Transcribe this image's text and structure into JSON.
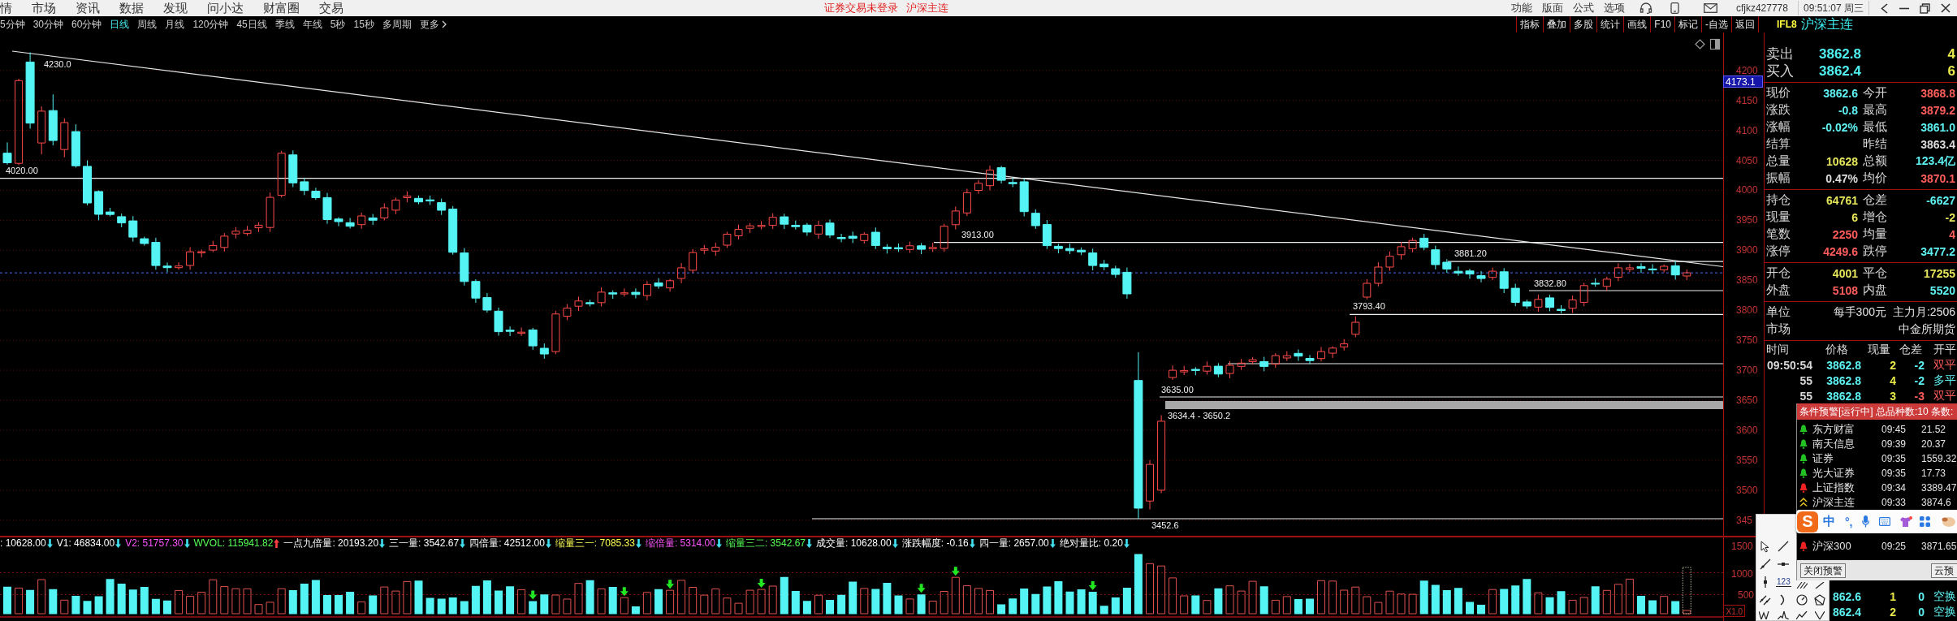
{
  "menu": {
    "items": [
      "情",
      "市场",
      "资讯",
      "数据",
      "发现",
      "问小达",
      "财富圈",
      "交易"
    ],
    "notices": [
      "证券交易未登录",
      "沪深主连"
    ],
    "links": [
      "功能",
      "版面",
      "公式",
      "选项"
    ],
    "account": "cfjkz427778",
    "clock": "09:51:07 周三"
  },
  "periods": [
    {
      "label": "5分钟",
      "selected": false
    },
    {
      "label": "30分钟",
      "selected": false
    },
    {
      "label": "60分钟",
      "selected": false
    },
    {
      "label": "日线",
      "selected": true
    },
    {
      "label": "周线",
      "selected": false
    },
    {
      "label": "月线",
      "selected": false
    },
    {
      "label": "120分钟",
      "selected": false
    },
    {
      "label": "45日线",
      "selected": false
    },
    {
      "label": "季线",
      "selected": false
    },
    {
      "label": "年线",
      "selected": false
    },
    {
      "label": "5秒",
      "selected": false
    },
    {
      "label": "15秒",
      "selected": false
    },
    {
      "label": "多周期",
      "selected": false
    }
  ],
  "more": "更多",
  "tools": [
    "指标",
    "叠加",
    "多股",
    "统计",
    "画线",
    "F10",
    "标记",
    "-自选",
    "返回"
  ],
  "symbol": {
    "code": "IFL8",
    "name": "沪深主连"
  },
  "chart": {
    "price_labels": [
      "4230.0",
      "4020.00",
      "3913.00",
      "3881.20",
      "3832.80",
      "3793.40",
      "3635.00",
      "3634.4 - 3650.2",
      "3452.6"
    ],
    "price_axis": [
      "4200",
      "4150",
      "4100",
      "4050",
      "4000",
      "3950",
      "3900",
      "3850",
      "3800",
      "3750",
      "3700",
      "3650",
      "3600",
      "3550",
      "3500",
      "345"
    ],
    "cursor_price": "4173.1"
  },
  "volume": {
    "indicators": [
      {
        "text": ": 10628.00",
        "color": "#ffffff",
        "arrow": {
          "kind": "down",
          "color": "#40e0f0"
        }
      },
      {
        "text": "V1: 46834.00",
        "color": "#ffffff",
        "arrow": {
          "kind": "down",
          "color": "#40e0f0"
        }
      },
      {
        "text": "V2: 51757.30",
        "color": "#ff55ff",
        "arrow": {
          "kind": "down",
          "color": "#40e0f0"
        }
      },
      {
        "text": "WVOL: 115941.82",
        "color": "#55ff55",
        "arrow": {
          "kind": "up",
          "color": "#ff4040"
        }
      },
      {
        "text": "一点九倍量: 20193.20",
        "color": "#ffffff",
        "arrow": {
          "kind": "down",
          "color": "#40e0f0"
        }
      },
      {
        "text": "三一量: 3542.67",
        "color": "#ffffff",
        "arrow": {
          "kind": "down",
          "color": "#40e0f0"
        }
      },
      {
        "text": "四倍量: 42512.00",
        "color": "#ffffff",
        "arrow": {
          "kind": "down",
          "color": "#40e0f0"
        }
      },
      {
        "text": "缩量三一: 7085.33",
        "color": "#ffff55",
        "arrow": {
          "kind": "down",
          "color": "#40e0f0"
        }
      },
      {
        "text": "缩倍量: 5314.00",
        "color": "#ff55ff",
        "arrow": {
          "kind": "down",
          "color": "#40e0f0"
        }
      },
      {
        "text": "缩量三二: 3542.67",
        "color": "#55ff55",
        "arrow": {
          "kind": "down",
          "color": "#40e0f0"
        }
      },
      {
        "text": "成交量: 10628.00",
        "color": "#ffffff",
        "arrow": {
          "kind": "down",
          "color": "#40e0f0"
        }
      },
      {
        "text": "涨跌幅度: -0.16",
        "color": "#ffffff",
        "arrow": {
          "kind": "down",
          "color": "#40e0f0"
        }
      },
      {
        "text": "四一量: 2657.00",
        "color": "#ffffff",
        "arrow": {
          "kind": "down",
          "color": "#40e0f0"
        }
      },
      {
        "text": "绝对量比: 0.20",
        "color": "#ffffff",
        "arrow": {
          "kind": "down",
          "color": "#40e0f0"
        }
      }
    ],
    "axis": [
      "1500",
      "1000",
      "500"
    ],
    "scale": "X1.0"
  },
  "quote": {
    "ask": {
      "label": "卖出",
      "price": "3862.8",
      "volume": "4"
    },
    "bid": {
      "label": "买入",
      "price": "3862.4",
      "volume": "6"
    },
    "stats": [
      [
        {
          "label": "现价",
          "value": "3862.6",
          "color": "#5ef2f2"
        },
        {
          "label": "今开",
          "value": "3868.8",
          "color": "#ff5c5c"
        },
        {
          "label": "涨跌",
          "value": "-0.8",
          "color": "#5ef2f2"
        },
        {
          "label": "最高",
          "value": "3879.2",
          "color": "#ff5c5c"
        },
        {
          "label": "涨幅",
          "value": "-0.02%",
          "color": "#5ef2f2"
        },
        {
          "label": "最低",
          "value": "3861.0",
          "color": "#5ef2f2"
        },
        {
          "label": "结算"
        },
        {
          "label": "昨结",
          "value": "3863.4",
          "color": "#dcdcdc"
        },
        {
          "label": "总量",
          "value": "10628",
          "color": "#e6e65a"
        },
        {
          "label": "总额",
          "value": "123.4亿",
          "color": "#5ef2f2"
        },
        {
          "label": "振幅",
          "value": "0.47%",
          "color": "#dcdcdc"
        },
        {
          "label": "均价",
          "value": "3870.1",
          "color": "#ff5c5c"
        }
      ],
      [
        {
          "label": "持仓",
          "value": "64761",
          "color": "#e6e65a"
        },
        {
          "label": "仓差",
          "value": "-6627",
          "color": "#5ef2f2"
        },
        {
          "label": "现量",
          "value": "6",
          "color": "#e6e65a"
        },
        {
          "label": "增仓",
          "value": "-2",
          "color": "#e6e65a"
        },
        {
          "label": "笔数",
          "value": "2250",
          "color": "#ff5c5c"
        },
        {
          "label": "均量",
          "value": "4",
          "color": "#ff5c5c"
        },
        {
          "label": "涨停",
          "value": "4249.6",
          "color": "#ff5c5c"
        },
        {
          "label": "跌停",
          "value": "3477.2",
          "color": "#5ef2f2"
        }
      ],
      [
        {
          "label": "开仓",
          "value": "4001",
          "color": "#e6e65a"
        },
        {
          "label": "平仓",
          "value": "17255",
          "color": "#e6e65a"
        },
        {
          "label": "外盘",
          "value": "5108",
          "color": "#ff5c5c"
        },
        {
          "label": "内盘",
          "value": "5520",
          "color": "#5ef2f2"
        }
      ]
    ],
    "info": [
      {
        "label": "单位",
        "values": [
          "每手300元",
          "主力月:2506"
        ]
      },
      {
        "label": "市场",
        "values": [
          "中金所期货"
        ]
      }
    ]
  },
  "ticks": {
    "columns": [
      "时间",
      "价格",
      "现量",
      "仓差",
      "开平"
    ],
    "rows": [
      {
        "time": "09:50:54",
        "price": "3862.8",
        "volume": "2",
        "change": {
          "text": "-2",
          "color": "#5ef2f2"
        },
        "type": {
          "text": "双平",
          "color": "#ff5c5c"
        }
      },
      {
        "time": "55",
        "price": "3862.8",
        "volume": "4",
        "change": {
          "text": "-2",
          "color": "#5ef2f2"
        },
        "type": {
          "text": "多平",
          "color": "#5ef2f2"
        }
      },
      {
        "time": "55",
        "price": "3862.8",
        "volume": "3",
        "change": {
          "text": "-3",
          "color": "#ff5c5c"
        },
        "type": {
          "text": "双平",
          "color": "#ff5c5c"
        }
      }
    ],
    "lower_rows": [
      {
        "price": "862.6",
        "volume": "1",
        "change": {
          "text": "0",
          "color": "#5ef2f2"
        },
        "type": {
          "text": "空换",
          "color": "#5ef2f2"
        }
      },
      {
        "price": "862.4",
        "volume": "2",
        "change": {
          "text": "0",
          "color": "#5ef2f2"
        },
        "type": {
          "text": "空换",
          "color": "#5ef2f2"
        }
      }
    ]
  },
  "alerts": {
    "title": "条件预警[运行中] 总品种数:10 条数:",
    "rows": [
      {
        "name": "东方财富",
        "time": "09:45",
        "value": "21.52",
        "kind": "bell",
        "color": "#22c022"
      },
      {
        "name": "南天信息",
        "time": "09:39",
        "value": "20.37",
        "kind": "bell",
        "color": "#22c022"
      },
      {
        "name": "证券",
        "time": "09:35",
        "value": "1559.32",
        "kind": "bell",
        "color": "#22c022"
      },
      {
        "name": "光大证券",
        "time": "09:35",
        "value": "17.73",
        "kind": "bell",
        "color": "#22c022"
      },
      {
        "name": "上证指数",
        "time": "09:34",
        "value": "3389.47",
        "kind": "bell",
        "color": "#ee2222"
      },
      {
        "name": "沪深主连",
        "time": "09:33",
        "value": "3874.6",
        "kind": "chevron",
        "color": "#e0c020"
      }
    ],
    "lower_rows": [
      {
        "name": "沪深300",
        "time": "09:25",
        "value": "3871.65",
        "kind": "bell",
        "color": "#ee2222"
      }
    ],
    "buttons": [
      "关闭预警",
      "云预"
    ]
  },
  "ime": {
    "logo": "S",
    "mode": "中",
    "punctuation": "°,"
  },
  "drawing_tools": {
    "number_label": "123"
  }
}
